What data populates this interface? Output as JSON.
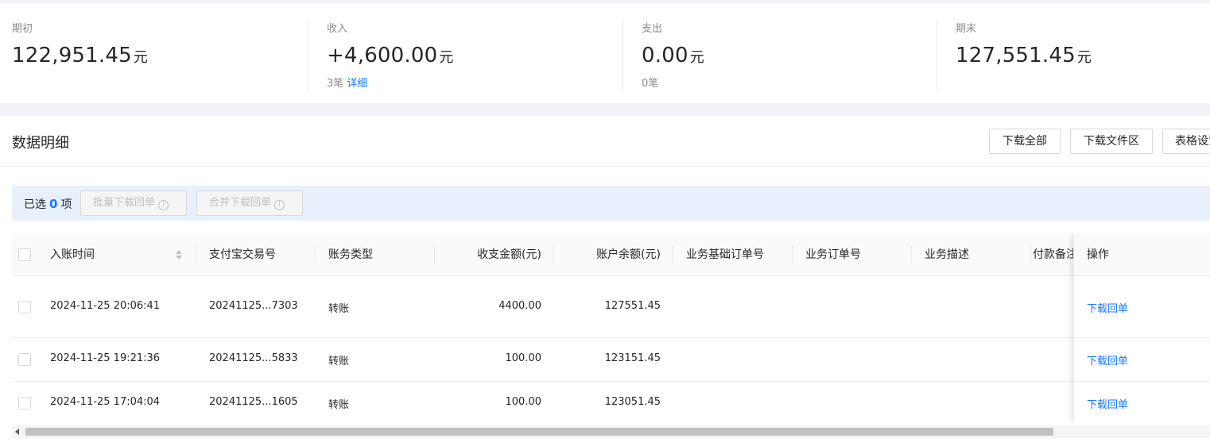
{
  "summary": {
    "opening": {
      "label": "期初",
      "value": "122,951.45",
      "unit": "元"
    },
    "income": {
      "label": "收入",
      "value": "+4,600.00",
      "unit": "元",
      "count": "3笔",
      "detail_link": "详细"
    },
    "expense": {
      "label": "支出",
      "value": "0.00",
      "unit": "元",
      "count": "0笔"
    },
    "closing": {
      "label": "期末",
      "value": "127,551.45",
      "unit": "元"
    }
  },
  "section": {
    "title": "数据明细",
    "buttons": {
      "download_all": "下载全部",
      "download_files": "下载文件区",
      "table_settings": "表格设置"
    }
  },
  "selection": {
    "prefix": "已选",
    "count": "0",
    "suffix": "项",
    "batch_download": "批量下载回单",
    "merge_download": "合并下载回单",
    "info_glyph": "i"
  },
  "table": {
    "headers": [
      "入账时间",
      "支付宝交易号",
      "账务类型",
      "收支金额(元)",
      "账户余额(元)",
      "业务基础订单号",
      "业务订单号",
      "业务描述",
      "付款备注",
      "操作"
    ],
    "rows": [
      {
        "time": "2024-11-25 20:06:41",
        "trade_no": "20241125...7303",
        "type": "转账",
        "amount": "4400.00",
        "balance": "127551.45",
        "action": "下载回单"
      },
      {
        "time": "2024-11-25 19:21:36",
        "trade_no": "20241125...5833",
        "type": "转账",
        "amount": "100.00",
        "balance": "123151.45",
        "action": "下载回单"
      },
      {
        "time": "2024-11-25 17:04:04",
        "trade_no": "20241125...1605",
        "type": "转账",
        "amount": "100.00",
        "balance": "123051.45",
        "action": "下载回单"
      }
    ]
  },
  "colors": {
    "accent": "#1677ff",
    "selection_bar": "#e8f0fd"
  }
}
